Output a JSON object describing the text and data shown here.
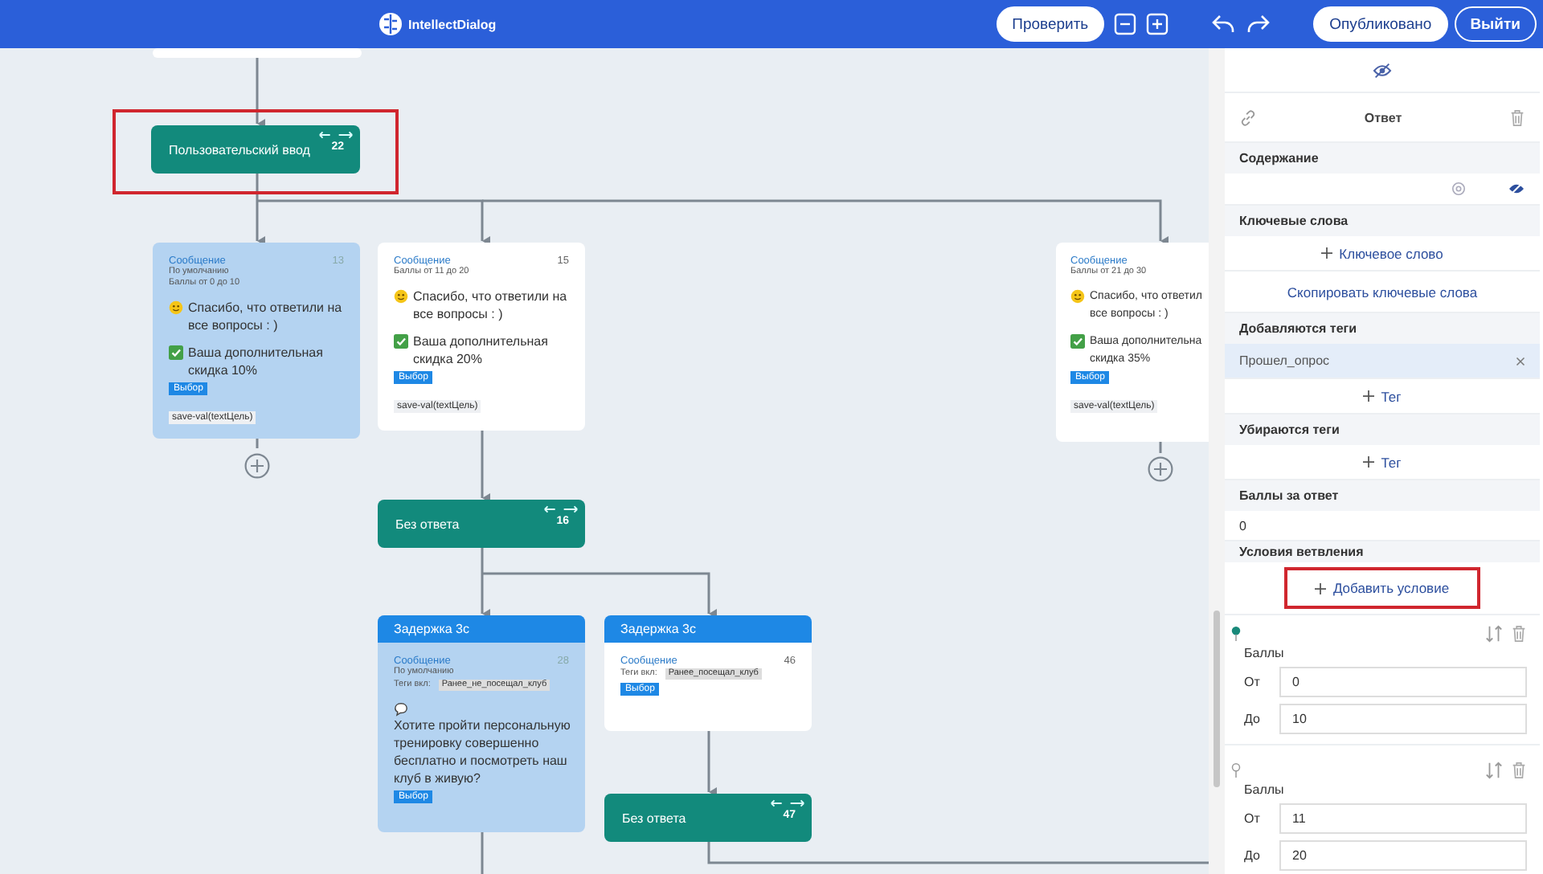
{
  "header": {
    "logo": "IntellectDialog",
    "check": "Проверить",
    "publish": "Опубликовано",
    "exit": "Выйти"
  },
  "nodes": [
    {
      "kind": "action",
      "title": "Пользовательский ввод",
      "number": "22",
      "highlighted": true
    },
    {
      "kind": "message",
      "selected": true,
      "title": "Сообщение",
      "number": "13",
      "meta": [
        "По умолчанию",
        "Баллы от 0 до 10"
      ],
      "paragraphs": [
        {
          "kind": "smile",
          "lines": [
            "Спасибо, что ответили на",
            "все вопросы : )"
          ]
        },
        {
          "kind": "check",
          "lines": [
            "Ваша дополнительная",
            "скидка 10%"
          ]
        }
      ],
      "choice": "Выбор",
      "action": "save-val(textЦель)",
      "add": true
    },
    {
      "kind": "message",
      "selected": false,
      "title": "Сообщение",
      "number": "15",
      "meta": [
        "Баллы от 11 до 20"
      ],
      "paragraphs": [
        {
          "kind": "smile",
          "lines": [
            "Спасибо, что ответили на",
            "все вопросы : )"
          ]
        },
        {
          "kind": "check",
          "lines": [
            "Ваша дополнительная",
            "скидка 20%"
          ]
        }
      ],
      "choice": "Выбор",
      "action": "save-val(textЦель)",
      "add": false
    },
    {
      "kind": "message",
      "selected": false,
      "title": "Сообщение",
      "meta": [
        "Баллы от 21 до 30"
      ],
      "paragraphs": [
        {
          "kind": "smile",
          "lines": [
            "Спасибо, что ответил",
            "все вопросы : )"
          ]
        },
        {
          "kind": "check",
          "lines": [
            "Ваша дополнительна",
            "скидка 35%"
          ]
        }
      ],
      "choice": "Выбор",
      "action": "save-val(textЦель)",
      "add": true
    },
    {
      "kind": "action",
      "title": "Без ответа",
      "number": "16",
      "highlighted": false
    },
    {
      "kind": "message",
      "selected": true,
      "header": "Задержка 3с",
      "title": "Сообщение",
      "number": "28",
      "meta": [
        "По умолчанию"
      ],
      "tag_label": "Теги вкл:",
      "tag": "Ранее_не_посещал_клуб",
      "paragraphs": [
        {
          "kind": "speech",
          "lines": [
            "Хотите пройти персональную",
            "тренировку совершенно",
            "бесплатно и посмотреть наш",
            "клуб в живую?"
          ]
        }
      ],
      "choice": "Выбор",
      "add": false
    },
    {
      "kind": "message",
      "selected": false,
      "header": "Задержка 3с",
      "title": "Сообщение",
      "number": "46",
      "tag_label": "Теги вкл:",
      "tag": "Ранее_посещал_клуб",
      "choice": "Выбор",
      "add": false
    },
    {
      "kind": "action",
      "title": "Без ответа",
      "number": "47",
      "highlighted": false
    }
  ],
  "panel": {
    "title": "Ответ",
    "content_header": "Содержание",
    "keywords": {
      "header": "Ключевые слова",
      "add": "Ключевое слово",
      "copy": "Скопировать ключевые слова"
    },
    "added_tags": {
      "header": "Добавляются теги",
      "tags": [
        "Прошел_опрос"
      ],
      "add": "Тег"
    },
    "removed_tags": {
      "header": "Убираются теги",
      "add": "Тег"
    },
    "score": {
      "header": "Баллы за ответ",
      "value": "0"
    },
    "conditions": {
      "header": "Условия ветвления",
      "add": "Добавить условие",
      "add_highlighted": true,
      "items": [
        {
          "pinned": true,
          "label": "Баллы",
          "from_label": "От",
          "from": "0",
          "to_label": "До",
          "to": "10"
        },
        {
          "pinned": false,
          "label": "Баллы",
          "from_label": "От",
          "from": "11",
          "to_label": "До",
          "to": "20"
        }
      ]
    }
  }
}
